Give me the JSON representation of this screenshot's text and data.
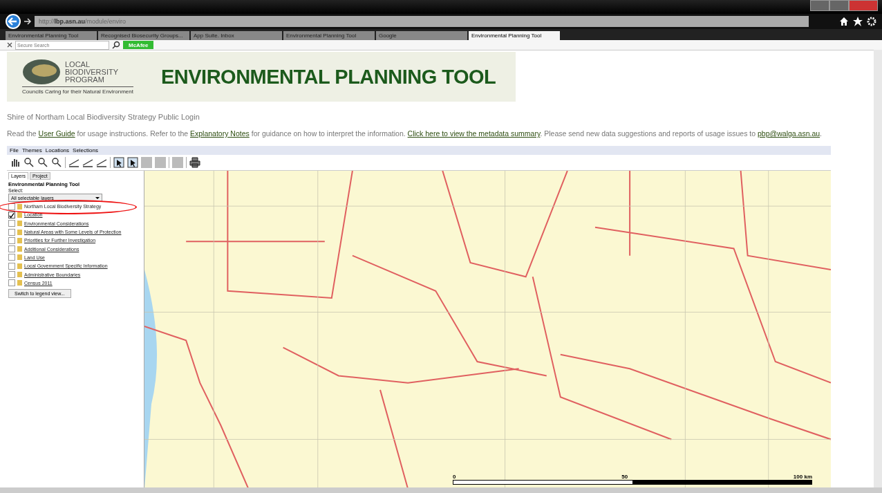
{
  "browser": {
    "url_host": "http://",
    "url_domain": "lbp.asn.au",
    "url_path": "/module/enviro",
    "tabs": [
      {
        "label": "Environmental Planning Tool",
        "selected": false
      },
      {
        "label": "Recognised Biosecurity Groups...",
        "selected": false
      },
      {
        "label": "App Suite. Inbox",
        "selected": false
      },
      {
        "label": "Environmental Planning Tool",
        "selected": false
      },
      {
        "label": "Google",
        "selected": false
      },
      {
        "label": "Environmental Planning Tool",
        "selected": true
      }
    ],
    "search_placeholder": "Secure Search",
    "addon": "McAfee"
  },
  "banner": {
    "logo_lines": [
      "LOCAL",
      "BIODIVERSITY",
      "PROGRAM"
    ],
    "tagline": "Councils Caring for their Natural Environment",
    "title": "ENVIRONMENTAL PLANNING TOOL"
  },
  "subtitle": "Shire of Northam Local Biodiversity Strategy Public Login",
  "intro": [
    {
      "kind": "text",
      "text": "Read the "
    },
    {
      "kind": "link",
      "text": "User Guide"
    },
    {
      "kind": "text",
      "text": " for usage instructions. Refer to the "
    },
    {
      "kind": "link",
      "text": "Explanatory Notes"
    },
    {
      "kind": "text",
      "text": " for guidance on how to interpret the information. "
    },
    {
      "kind": "link",
      "text": "Click here to view the metadata summary"
    },
    {
      "kind": "text",
      "text": ". Please send new data suggestions and reports of usage issues to "
    },
    {
      "kind": "link",
      "text": "pbp@walga.asn.au"
    },
    {
      "kind": "text",
      "text": "."
    }
  ],
  "menu": [
    "File",
    "Themes",
    "Locations",
    "Selections"
  ],
  "panel": {
    "tabs": [
      {
        "label": "Layers",
        "selected": true
      },
      {
        "label": "Project",
        "selected": false
      }
    ],
    "title": "Environmental Planning Tool",
    "select_label": "Select:",
    "select_value": "All selectable layers",
    "layers": [
      {
        "label": "Northam Local Biodiversity Strategy",
        "checked": false,
        "highlighted": true
      },
      {
        "label": "Location",
        "checked": true,
        "highlighted": false
      },
      {
        "label": "Environmental Considerations",
        "checked": false,
        "highlighted": false
      },
      {
        "label": "Natural Areas with Some Levels of Protection",
        "checked": false,
        "highlighted": false
      },
      {
        "label": "Priorities for Further Investigation",
        "checked": false,
        "highlighted": false
      },
      {
        "label": "Additional Considerations",
        "checked": false,
        "highlighted": false
      },
      {
        "label": "Land Use",
        "checked": false,
        "highlighted": false
      },
      {
        "label": "Local Government Specific Information",
        "checked": false,
        "highlighted": false
      },
      {
        "label": "Administrative Boundaries",
        "checked": false,
        "highlighted": false
      },
      {
        "label": "Census 2011",
        "checked": false,
        "highlighted": false
      }
    ],
    "legend_button": "Switch to legend view..."
  },
  "map": {
    "scale_labels": [
      "0",
      "50",
      "100 km"
    ]
  }
}
